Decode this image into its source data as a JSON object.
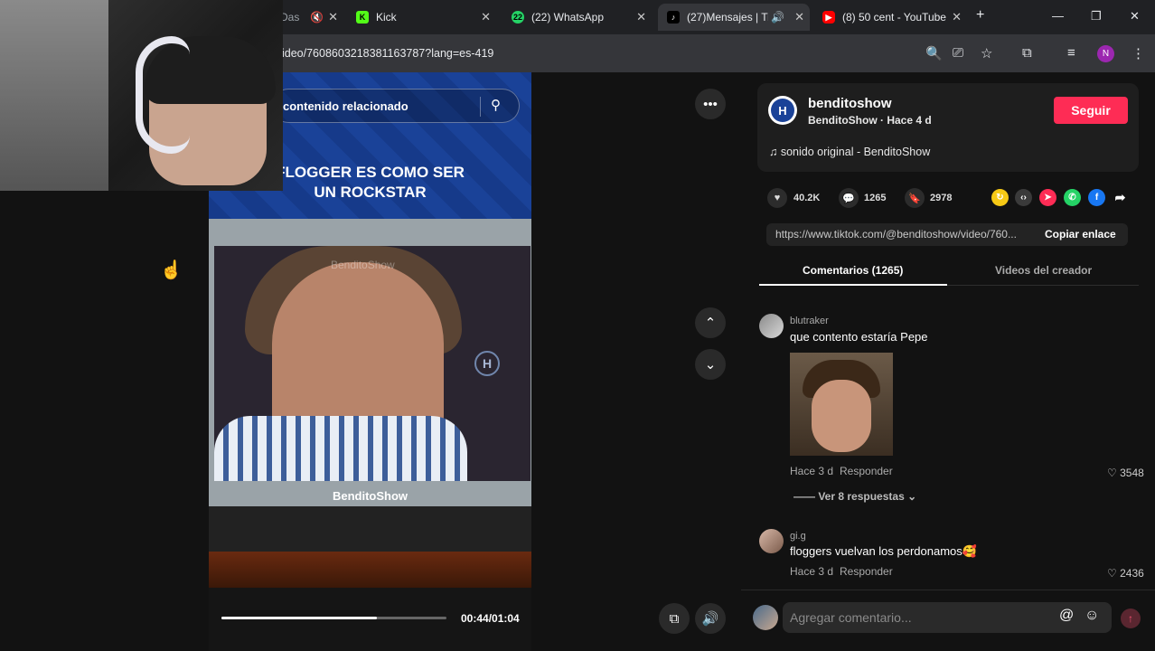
{
  "browser": {
    "tabs": [
      {
        "label": "Das",
        "icon": "mute-icon"
      },
      {
        "label": "Kick",
        "icon": "kick-logo-icon"
      },
      {
        "label": "(22) WhatsApp",
        "badge": "22",
        "icon": "whatsapp-icon"
      },
      {
        "label": "(27)Mensajes | Ti",
        "icon": "tiktok-icon"
      },
      {
        "label": "(8) 50 cent - YouTube",
        "icon": "youtube-icon"
      }
    ],
    "new_tab": "+",
    "url": "ideo/7608603218381163787?lang=es-419",
    "profile_initial": "N"
  },
  "video": {
    "search_placeholder": "contenido relacionado",
    "title_line1": "FLOGGER ES COMO SER",
    "title_line2": "UN ROCKSTAR",
    "tv_label": "BenditoShow",
    "watermark": "BenditoShow",
    "time": "00:44/01:04",
    "progress": 0.69
  },
  "creator": {
    "name": "benditoshow",
    "subtitle": "BenditoShow · Hace 4 d",
    "follow_label": "Seguir",
    "sound": "sonido original - BenditoShow"
  },
  "stats": {
    "likes": "40.2K",
    "comments": "1265",
    "saves": "2978"
  },
  "link": {
    "url": "https://www.tiktok.com/@benditoshow/video/760...",
    "copy_label": "Copiar enlace"
  },
  "tabs": {
    "comments": "Comentarios (1265)",
    "creator_videos": "Videos del creador"
  },
  "comments": [
    {
      "user": "blutraker",
      "text": "que contento estaría Pepe",
      "time": "Hace 3 d",
      "reply": "Responder",
      "likes": "3548",
      "view_replies": "Ver 8 respuestas"
    },
    {
      "user": "gi.g",
      "text": "floggers vuelvan los perdonamos🥰",
      "time": "Hace 3 d",
      "reply": "Responder",
      "likes": "2436"
    }
  ],
  "comment_input": {
    "placeholder": "Agregar comentario..."
  },
  "colors": {
    "accent": "#fe2c55",
    "bg": "#121212"
  }
}
